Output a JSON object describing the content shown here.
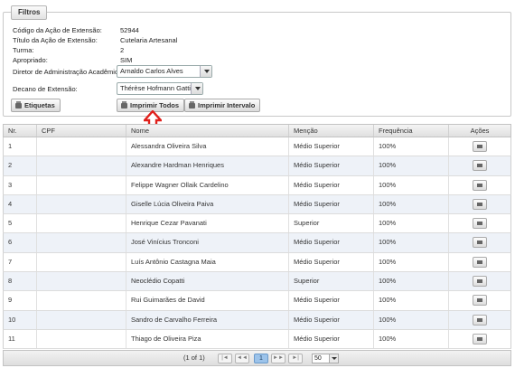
{
  "filters": {
    "legend": "Filtros",
    "fields": [
      {
        "label": "Código da Ação de Extensão:",
        "value": "52944"
      },
      {
        "label": "Título da Ação de Extensão:",
        "value": "Cutelaria Artesanal"
      },
      {
        "label": "Turma:",
        "value": "2"
      },
      {
        "label": "Apropriado:",
        "value": "SIM"
      }
    ],
    "director_label": "Diretor de Administração Acadêmica:",
    "director_value": "Arnaldo Carlos Alves",
    "dean_label": "Decano de Extensão:",
    "dean_value": "Thérèse Hofmann Gatti",
    "buttons": {
      "labels": "Etiquetas",
      "print_all": "Imprimir Todos",
      "print_range": "Imprimir Intervalo"
    }
  },
  "table": {
    "headers": [
      "Nr.",
      "CPF",
      "Nome",
      "Menção",
      "Frequência",
      "Ações"
    ],
    "rows": [
      {
        "nr": "1",
        "cpf": "",
        "nome": "Alessandra Oliveira Silva",
        "mencao": "Médio Superior",
        "freq": "100%"
      },
      {
        "nr": "2",
        "cpf": "",
        "nome": "Alexandre Hardman Henriques",
        "mencao": "Médio Superior",
        "freq": "100%"
      },
      {
        "nr": "3",
        "cpf": "",
        "nome": "Felippe Wagner Ollaik Cardelino",
        "mencao": "Médio Superior",
        "freq": "100%"
      },
      {
        "nr": "4",
        "cpf": "",
        "nome": "Giselle Lúcia Oliveira Paiva",
        "mencao": "Médio Superior",
        "freq": "100%"
      },
      {
        "nr": "5",
        "cpf": "",
        "nome": "Henrique Cezar Pavanati",
        "mencao": "Superior",
        "freq": "100%"
      },
      {
        "nr": "6",
        "cpf": "",
        "nome": "José Vinícius Tronconi",
        "mencao": "Médio Superior",
        "freq": "100%"
      },
      {
        "nr": "7",
        "cpf": "",
        "nome": "Luís Antônio Castagna Maia",
        "mencao": "Médio Superior",
        "freq": "100%"
      },
      {
        "nr": "8",
        "cpf": "",
        "nome": "Neoclédio Copatti",
        "mencao": "Superior",
        "freq": "100%"
      },
      {
        "nr": "9",
        "cpf": "",
        "nome": "Rui Guimarães de David",
        "mencao": "Médio Superior",
        "freq": "100%"
      },
      {
        "nr": "10",
        "cpf": "",
        "nome": "Sandro de Carvalho Ferreira",
        "mencao": "Médio Superior",
        "freq": "100%"
      },
      {
        "nr": "11",
        "cpf": "",
        "nome": "Thiago de Oliveira Piza",
        "mencao": "Médio Superior",
        "freq": "100%"
      }
    ]
  },
  "pager": {
    "info": "(1 of 1)",
    "first": "|◄",
    "prev": "◄◄",
    "current_page": "1",
    "next": "►►",
    "last": "►|",
    "rows_per_page": "50"
  },
  "colors": {
    "annotation_arrow": "#e0201b",
    "alt_row": "#eef2f8",
    "active_page": "#9cc3ea"
  }
}
